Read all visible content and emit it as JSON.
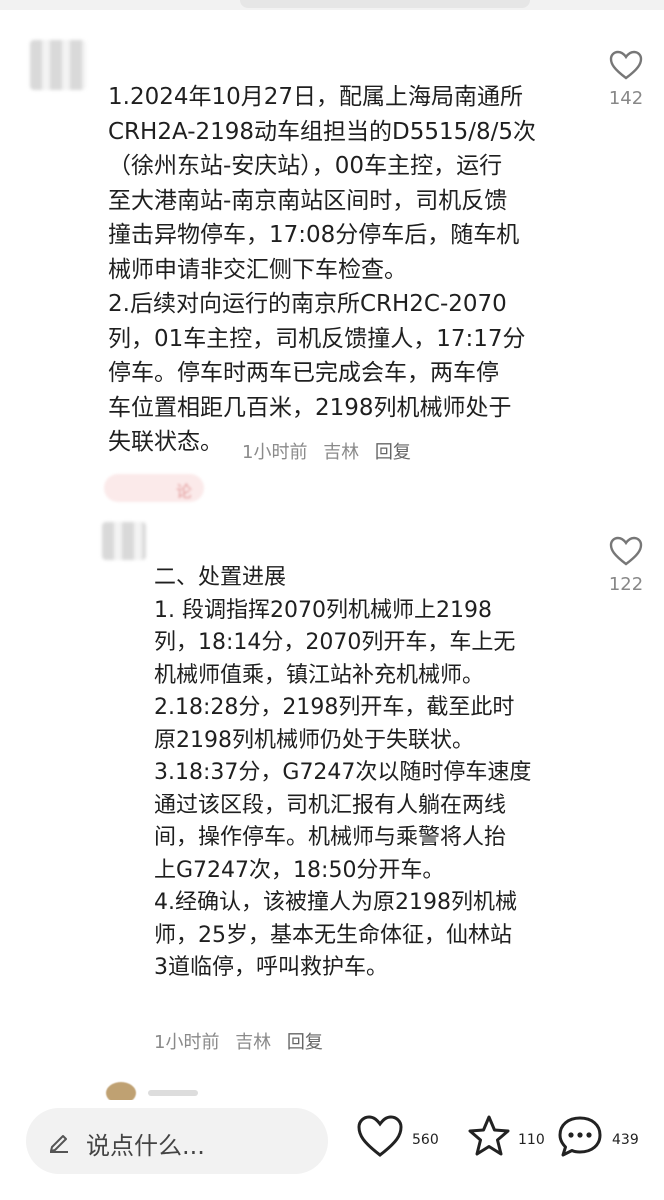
{
  "comment_1": {
    "text": "1.2024年10月27日，配属上海局南通所\nCRH2A-2198动车组担当的D5515/8/5次\n（徐州东站-安庆站），00车主控，运行\n至大港南站-南京南站区间时，司机反馈\n撞击异物停车，17:08分停车后，随车机\n械师申请非交汇侧下车检查。\n2.后续对向运行的南京所CRH2C-2070\n列，01车主控，司机反馈撞人，17:17分\n停车。停车时两车已完成会车，两车停\n车位置相距几百米，2198列机械师处于\n失联状态。",
    "time": "1小时前",
    "location": "吉林",
    "reply_label": "回复",
    "likes": "142"
  },
  "blurred_tag_text": "论",
  "comment_2": {
    "text": "二、处置进展\n1. 段调指挥2070列机械师上2198\n列，18:14分，2070列开车，车上无\n机械师值乘，镇江站补充机械师。\n2.18:28分，2198列开车，截至此时\n原2198列机械师仍处于失联状。\n3.18:37分，G7247次以随时停车速度\n通过该区段，司机汇报有人躺在两线\n间，操作停车。机械师与乘警将人抬\n上G7247次，18:50分开车。\n4.经确认，该被撞人为原2198列机械\n师，25岁，基本无生命体征，仙林站\n3道临停，呼叫救护车。",
    "time": "1小时前",
    "location": "吉林",
    "reply_label": "回复",
    "likes": "122"
  },
  "bottom_bar": {
    "input_placeholder": "说点什么...",
    "like_count": "560",
    "star_count": "110",
    "comment_count": "439",
    "icons": [
      "pencil-icon",
      "heart-icon",
      "star-icon",
      "comment-icon"
    ]
  }
}
